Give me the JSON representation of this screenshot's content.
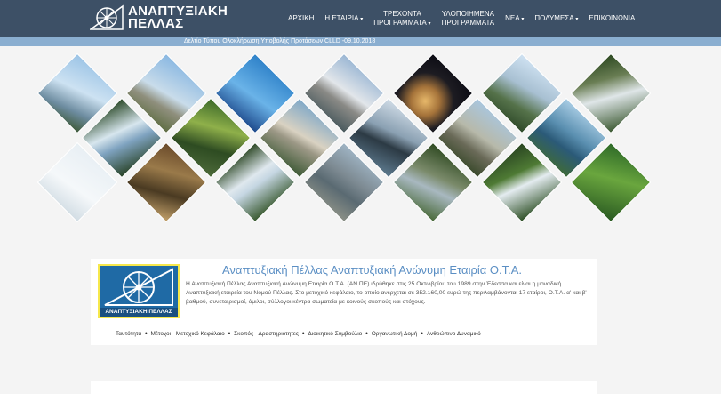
{
  "header": {
    "logo_line1": "ΑΝΑΠΤΥΞΙΑΚΗ",
    "logo_line2": "ΠΕΛΛΑΣ",
    "nav": [
      {
        "line1": "ΑΡΧΙΚΗ",
        "line2": ""
      },
      {
        "line1": "Η ΕΤΑΙΡΙΑ",
        "line2": "",
        "caret": "▾"
      },
      {
        "line1": "ΤΡΕΧΟΝΤΑ",
        "line2": "ΠΡΟΓΡΑΜΜΑΤΑ",
        "caret": "▾"
      },
      {
        "line1": "ΥΛΟΠΟΙΗΜΕΝΑ",
        "line2": "ΠΡΟΓΡΑΜΜΑΤΑ"
      },
      {
        "line1": "ΝΕΑ",
        "line2": "",
        "caret": "▾"
      },
      {
        "line1": "ΠΟΛΥΜΕΣΑ",
        "line2": "",
        "caret": "▾"
      },
      {
        "line1": "ΕΠΙΚΟΙΝΩΝΙΑ",
        "line2": ""
      }
    ]
  },
  "ticker": {
    "text": "Δελτίο Τύπου Ολοκλήρωση Υποβολής Προτάσεων CLLD -09.10.2018"
  },
  "card": {
    "logo_label": "ΑΝΑΠΤΥΞΙΑΚΗ ΠΕΛΛΑΣ",
    "title": "Αναπτυξιακή Πέλλας Αναπτυξιακή Ανώνυμη Εταιρία Ο.Τ.Α.",
    "text": "Η Αναπτυξιακή Πέλλας Αναπτυξιακή Ανώνυμη Εταιρία Ο.Τ.Α. (ΑΝ.ΠΕ) ιδρύθηκε στις 25 Οκτωβρίου του 1989 στην Έδεσσα και είναι η μοναδική Αναπτυξιακή εταιρεία του Νομού Πέλλας. Στο μετοχικό κεφάλαιο, το οποίο ανέρχεται σε 352.160,00 ευρώ της περιλαμβάνονται 17 εταίροι, Ο.Τ.Α. α' και β' βαθμού, συνεταιρισμοί, όμιλοι, σύλλογοι κέντρα σωματεία με κοινούς σκοπούς και στόχους.",
    "links": [
      "Ταυτότητα",
      "Μέτοχοι - Μετοχικό Κεφάλαιο",
      "Σκοπός - Δραστηριότητες",
      "Διοικητικό Συμβούλιο",
      "Οργανωτική Δομή",
      "Ανθρώπινο Δυναμικό"
    ],
    "separator": "•"
  }
}
